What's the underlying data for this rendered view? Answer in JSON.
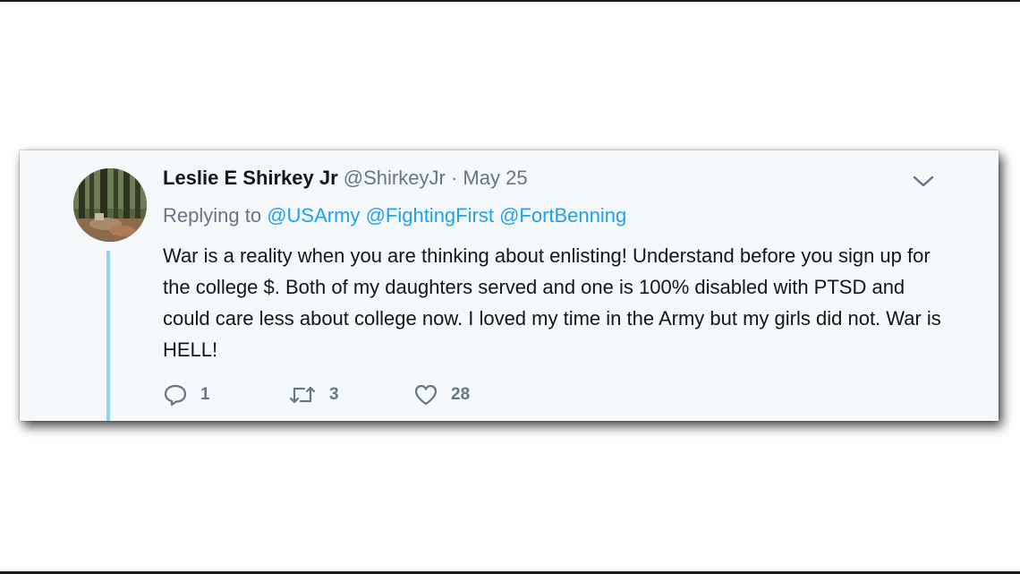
{
  "tweet": {
    "display_name": "Leslie E Shirkey Jr",
    "handle": "@ShirkeyJr",
    "separator": "·",
    "date": "May 25",
    "replying_to_label": "Replying to",
    "mentions": [
      "@USArmy",
      "@FightingFirst",
      "@FortBenning"
    ],
    "text": "War is a reality when you are thinking about enlisting! Understand before you sign up for the college $. Both of my daughters served and one is 100% disabled with PTSD and could care less about college now. I loved my time in the Army but my girls did not. War is HELL!",
    "actions": {
      "reply_icon": "reply-icon",
      "reply_count": "1",
      "retweet_icon": "retweet-icon",
      "retweet_count": "3",
      "like_icon": "heart-icon",
      "like_count": "28"
    },
    "menu_icon": "chevron-down-icon",
    "colors": {
      "card_background": "#f5f8fa",
      "mention": "#1da1f2",
      "thread_line": "#8bd3ee",
      "secondary_text": "#657786",
      "primary_text": "#14171a"
    }
  }
}
